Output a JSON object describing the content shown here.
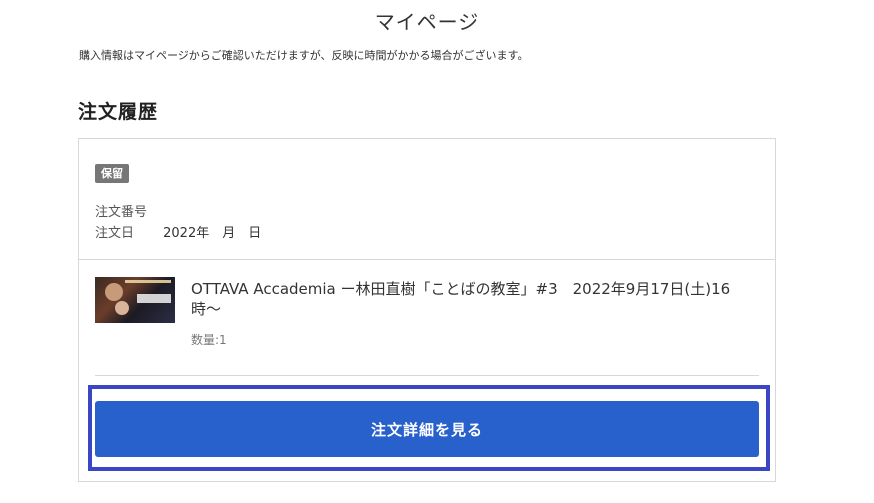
{
  "page": {
    "title": "マイページ",
    "notice": "購入情報はマイページからご確認いただけますが、反映に時間がかかる場合がございます。"
  },
  "orders_section": {
    "title": "注文履歴"
  },
  "order": {
    "status": "保留",
    "order_number_label": "注文番号",
    "order_number": "",
    "order_date_label": "注文日",
    "order_date": "2022年　月　日",
    "item": {
      "title": "OTTAVA Accademia ー林田直樹「ことばの教室」#3　2022年9月17日(土)16時〜",
      "quantity": "数量:1"
    },
    "detail_button_label": "注文詳細を見る"
  },
  "colors": {
    "button": "#2860cc",
    "focus_ring": "#3b46c4",
    "badge": "#777777"
  }
}
